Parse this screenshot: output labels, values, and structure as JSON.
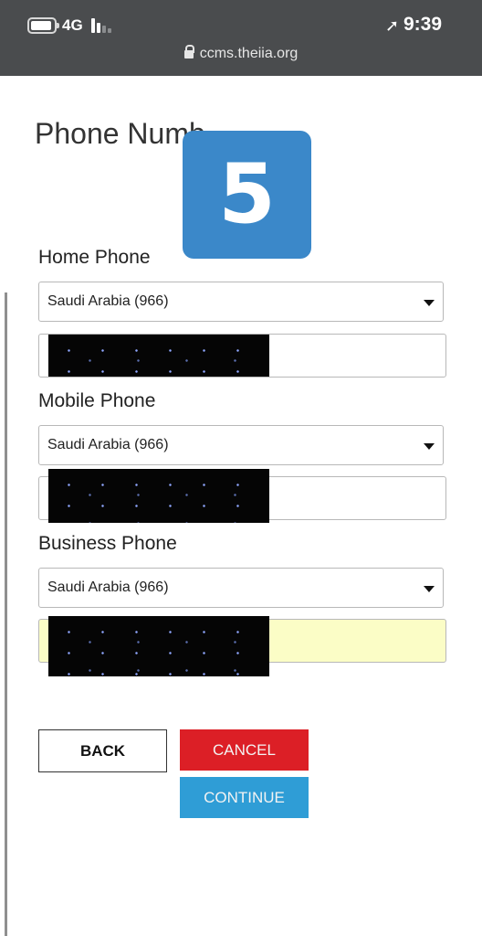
{
  "status_bar": {
    "network": "4G",
    "time": "9:39",
    "url": "ccms.theiia.org",
    "icons": [
      "battery-icon",
      "signal-icon",
      "location-arrow-icon",
      "lock-icon"
    ]
  },
  "page": {
    "title": "Phone Numb",
    "step_number": "5"
  },
  "form": {
    "home": {
      "label": "Home Phone",
      "country": "Saudi Arabia (966)"
    },
    "mobile": {
      "label": "Mobile Phone",
      "country": "Saudi Arabia (966)"
    },
    "business": {
      "label": "Business Phone",
      "country": "Saudi Arabia (966)"
    }
  },
  "buttons": {
    "back": "BACK",
    "cancel": "CANCEL",
    "continue": "CONTINUE"
  },
  "colors": {
    "status_bar_bg": "#4a4c4e",
    "badge_blue": "#3b88c9",
    "cancel_red": "#dc1f26",
    "continue_blue": "#2f9dd6",
    "autofill_yellow": "#fbfdc6"
  }
}
